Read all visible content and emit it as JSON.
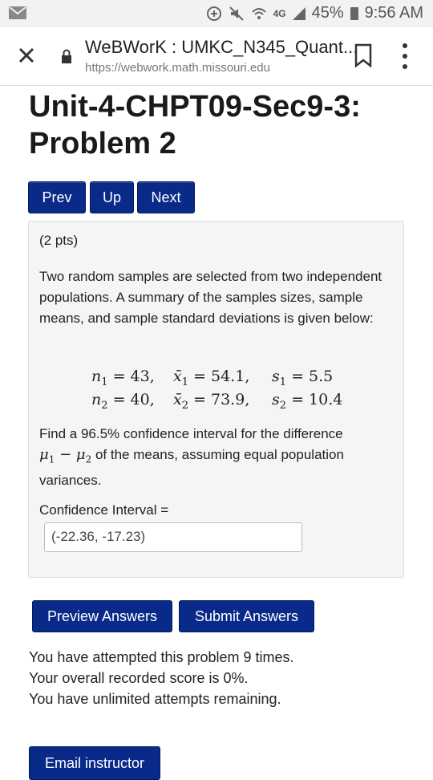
{
  "status_bar": {
    "signal_label": "4G",
    "battery": "45%",
    "time": "9:56 AM",
    "icons": [
      "gmail-icon",
      "data-saver-icon",
      "mute-icon",
      "wifi-icon",
      "signal-icon",
      "battery-icon"
    ]
  },
  "browser": {
    "page_title": "WeBWorK : UMKC_N345_Quant...",
    "url": "https://webwork.math.missouri.edu"
  },
  "problem": {
    "title": "Unit-4-CHPT09-Sec9-3: Problem 2",
    "nav": {
      "prev": "Prev",
      "up": "Up",
      "next": "Next"
    },
    "points": "(2 pts)",
    "statement": "Two random samples are selected from two independent populations. A summary of the samples sizes, sample means, and sample standard deviations is given below:",
    "math": {
      "n1": "43",
      "xbar1": "54.1",
      "s1": "5.5",
      "n2": "40",
      "xbar2": "73.9",
      "s2": "10.4"
    },
    "find_pre": "Find a 96.5% confidence interval for the difference",
    "find_post": "of the means, assuming equal population variances.",
    "ci_label": "Confidence Interval =",
    "ci_value": "(-22.36, -17.23)"
  },
  "actions": {
    "preview": "Preview Answers",
    "submit": "Submit Answers"
  },
  "attempt_info": {
    "line1": "You have attempted this problem 9 times.",
    "line2": "Your overall recorded score is 0%.",
    "line3": "You have unlimited attempts remaining."
  },
  "footer": {
    "email": "Email instructor"
  }
}
